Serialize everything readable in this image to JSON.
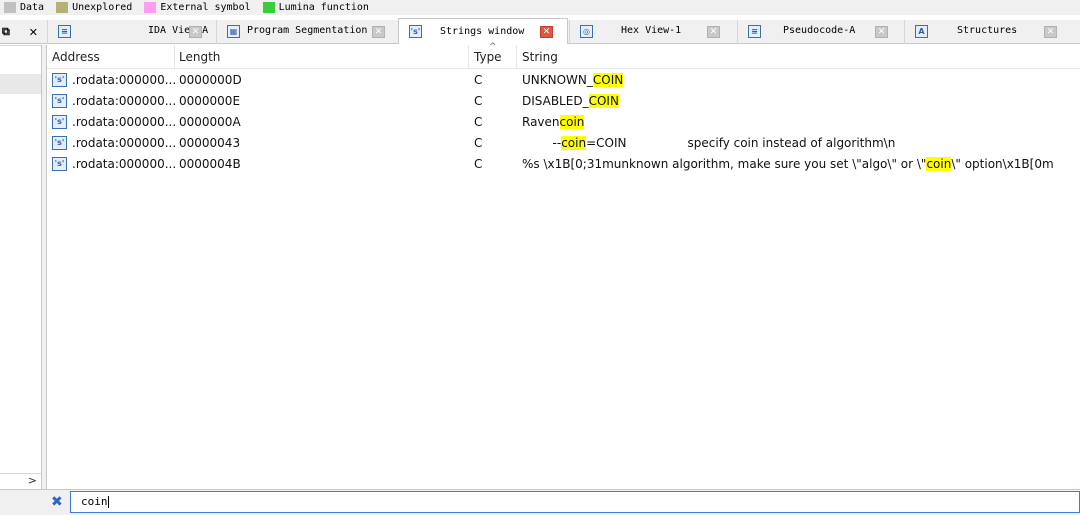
{
  "legend": [
    {
      "label": "Data",
      "color": "#c0c0c0"
    },
    {
      "label": "Unexplored",
      "color": "#b5b077"
    },
    {
      "label": "External symbol",
      "color": "#ff9cf0"
    },
    {
      "label": "Lumina function",
      "color": "#3acd3a"
    }
  ],
  "left_controls": {
    "restore": "⧉",
    "close": "✕"
  },
  "tabs": [
    {
      "label": "IDA View-A",
      "icon": "ida-view-icon",
      "glyph": "≡",
      "active": false
    },
    {
      "label": "Program Segmentation",
      "icon": "segmentation-icon",
      "glyph": "▦",
      "active": false
    },
    {
      "label": "Strings window",
      "icon": "strings-icon",
      "glyph": "'s'",
      "active": true
    },
    {
      "label": "Hex View-1",
      "icon": "hex-view-icon",
      "glyph": "◎",
      "active": false
    },
    {
      "label": "Pseudocode-A",
      "icon": "pseudocode-icon",
      "glyph": "≡",
      "active": false
    },
    {
      "label": "Structures",
      "icon": "structures-icon",
      "glyph": "A",
      "active": false
    }
  ],
  "columns": {
    "address": "Address",
    "length": "Length",
    "type": "Type",
    "string": "String",
    "sort_indicator": "^"
  },
  "rows": [
    {
      "address": ".rodata:000000...",
      "length": "0000000D",
      "type": "C",
      "string": [
        {
          "t": "UNKNOWN_",
          "h": false
        },
        {
          "t": "COIN",
          "h": true
        }
      ]
    },
    {
      "address": ".rodata:000000...",
      "length": "0000000E",
      "type": "C",
      "string": [
        {
          "t": "DISABLED_",
          "h": false
        },
        {
          "t": "COIN",
          "h": true
        }
      ]
    },
    {
      "address": ".rodata:000000...",
      "length": "0000000A",
      "type": "C",
      "string": [
        {
          "t": "Raven",
          "h": false
        },
        {
          "t": "coin",
          "h": true
        }
      ]
    },
    {
      "address": ".rodata:000000...",
      "length": "00000043",
      "type": "C",
      "string": [
        {
          "t": "        --",
          "h": false
        },
        {
          "t": "coin",
          "h": true
        },
        {
          "t": "=COIN                specify coin instead of algorithm\\n",
          "h": false
        }
      ]
    },
    {
      "address": ".rodata:000000...",
      "length": "0000004B",
      "type": "C",
      "string": [
        {
          "t": "%s \\x1B[0;31munknown algorithm, make sure you set \\\"algo\\\" or \\\"",
          "h": false
        },
        {
          "t": "coin",
          "h": true
        },
        {
          "t": "\\\" option\\x1B[0m",
          "h": false
        }
      ]
    }
  ],
  "filter": {
    "value": "coin",
    "clear_icon": "✖"
  },
  "scroll_arrow": ">"
}
